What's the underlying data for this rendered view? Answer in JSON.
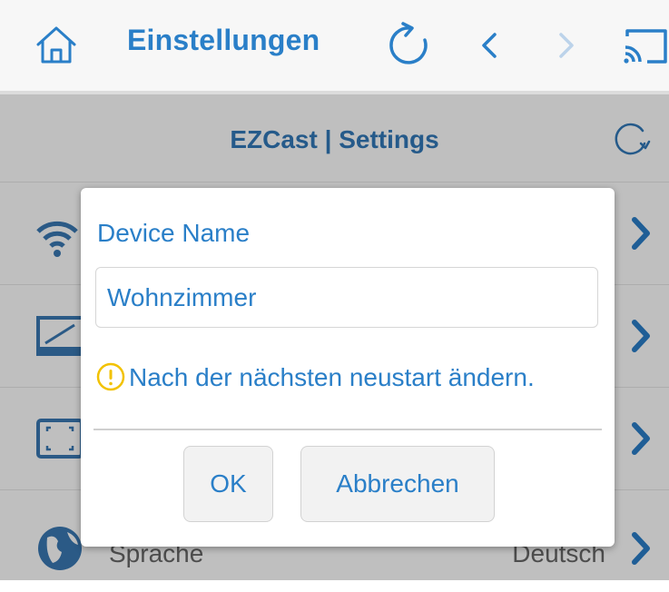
{
  "topbar": {
    "title": "Einstellungen",
    "icons": [
      "home-icon",
      "refresh-icon",
      "back-icon",
      "forward-icon",
      "cast-icon"
    ]
  },
  "settings_screen": {
    "title": "EZCast | Settings",
    "reload_icon": "reload-icon",
    "rows": [
      {
        "icon": "wifi-globe-icon"
      },
      {
        "icon": "monitor-icon"
      },
      {
        "icon": "screen-fit-icon"
      },
      {
        "icon": "globe-icon",
        "label": "Sprache",
        "value": "Deutsch"
      }
    ]
  },
  "dialog": {
    "title": "Device Name",
    "input_value": "Wohnzimmer",
    "note_icon": "warning-icon",
    "note": "Nach der nächsten neustart ändern.",
    "ok_label": "OK",
    "cancel_label": "Abbrechen"
  },
  "colors": {
    "accent": "#2a7fc8",
    "warning": "#f2c200",
    "overlay_bg": "#bfbfbf",
    "screen_title": "#255a8a"
  }
}
